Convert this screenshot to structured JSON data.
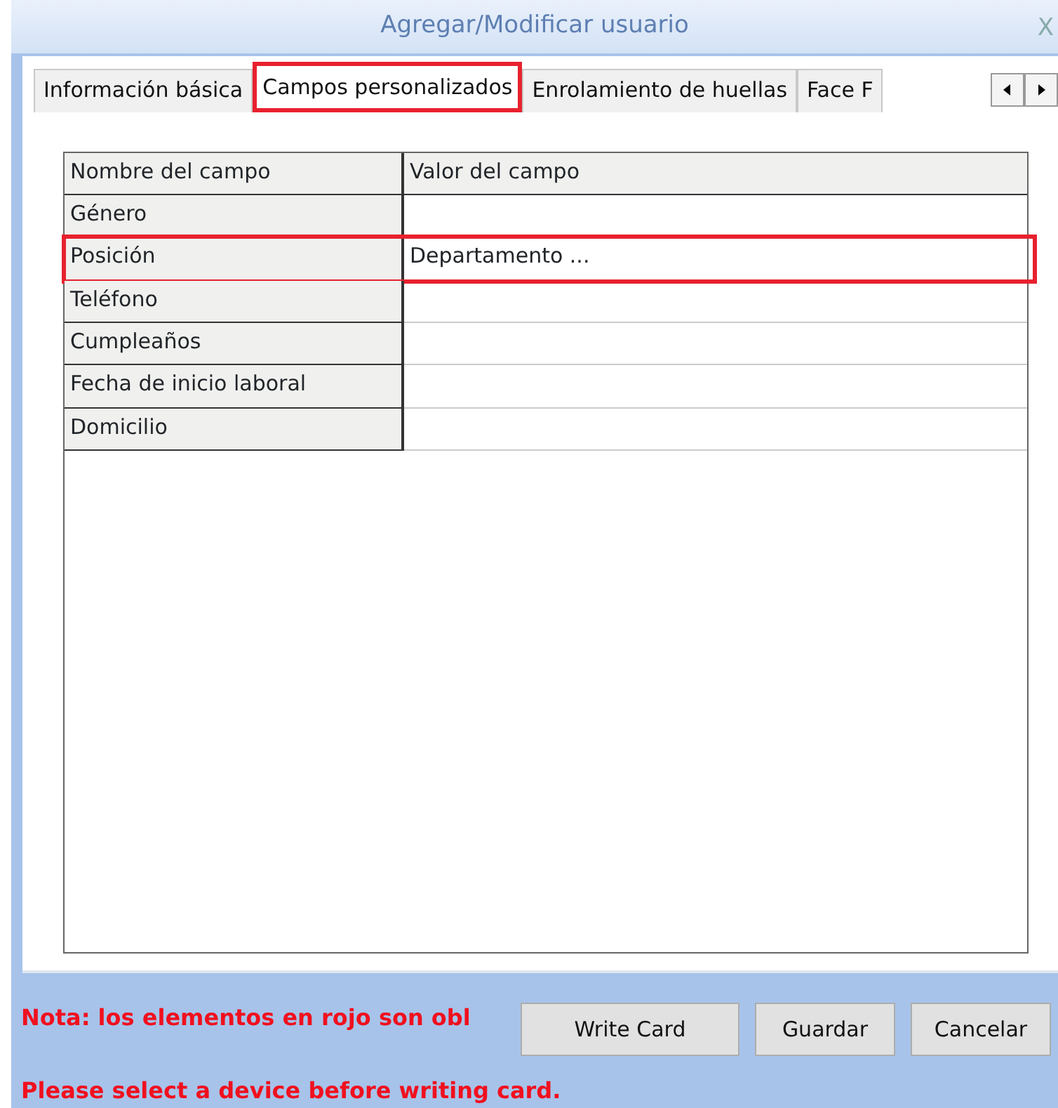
{
  "window": {
    "title": "Agregar/Modificar usuario",
    "close": "X"
  },
  "tabs": [
    {
      "label": "Información básica",
      "selected": false,
      "highlighted": false
    },
    {
      "label": "Campos personalizados",
      "selected": true,
      "highlighted": true
    },
    {
      "label": "Enrolamiento de huellas",
      "selected": false,
      "highlighted": false
    },
    {
      "label": "Face F",
      "selected": false,
      "highlighted": false
    }
  ],
  "table": {
    "columns": [
      "Nombre del campo",
      "Valor del campo"
    ],
    "rows": [
      {
        "name": "Género",
        "highlighted": false
      },
      {
        "name": "Posición",
        "value": "Departamento ...",
        "highlighted": true
      },
      {
        "name": "Teléfono",
        "highlighted": false
      },
      {
        "name": "Cumpleaños",
        "highlighted": false
      },
      {
        "name": "Fecha de inicio laboral",
        "highlighted": false
      },
      {
        "name": "Domicilio",
        "highlighted": false
      }
    ]
  },
  "note": "Nota: los elementos en rojo son obl",
  "buttons": [
    "Write Card",
    "Guardar",
    "Cancelar"
  ],
  "message": "Please select a device before writing card."
}
